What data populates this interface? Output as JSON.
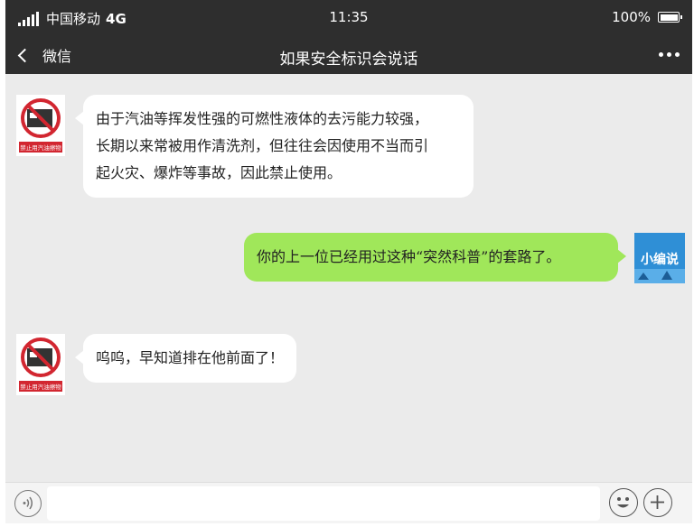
{
  "status": {
    "carrier": "中国移动",
    "network": "4G",
    "time": "11:35",
    "battery": "100%",
    "battery_level": 1.0
  },
  "nav": {
    "back_label": "微信",
    "title": "如果安全标识会说话"
  },
  "messages": [
    {
      "sender": "sign",
      "side": "left",
      "avatar_text": "禁止用汽油擦物",
      "lines": [
        "由于汽油等挥发性强的可燃性液体的去污能力较强，",
        "长期以来常被用作清洗剂，但往往会因使用不当而引",
        "起火灾、爆炸等事故，因此禁止使用。"
      ]
    },
    {
      "sender": "editor",
      "side": "right",
      "avatar_text": "小编说",
      "lines": [
        "你的上一位已经用过这种“突然科普”的套路了。"
      ]
    },
    {
      "sender": "sign",
      "side": "left",
      "avatar_text": "禁止用汽油擦物",
      "lines": [
        "呜呜，早知道排在他前面了！"
      ]
    }
  ],
  "icons": {
    "back": "chevron-left-icon",
    "more": "more-icon",
    "voice": "voice-icon",
    "emoji": "emoji-icon",
    "plus": "plus-icon"
  },
  "colors": {
    "bar": "#2e2e2e",
    "chat_bg": "#ebebeb",
    "outgoing_bubble": "#a0e75a",
    "incoming_bubble": "#ffffff",
    "sign_red": "#d22630",
    "editor_blue": "#2f8fd6"
  }
}
